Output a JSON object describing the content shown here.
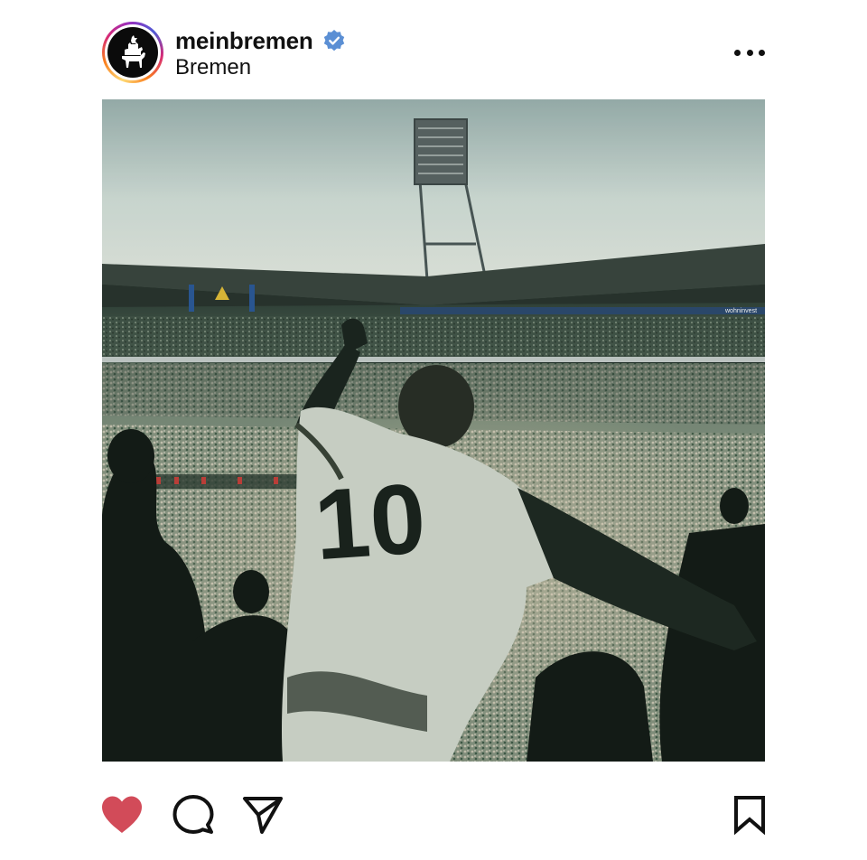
{
  "post": {
    "username": "meinbremen",
    "verified": true,
    "location": "Bremen",
    "liked": true
  },
  "icons": {
    "avatar": "bremen-town-musicians-logo-icon",
    "verified": "verified-badge-icon",
    "more": "more-options-icon",
    "like": "heart-icon",
    "comment": "comment-icon",
    "share": "paper-plane-icon",
    "save": "bookmark-icon"
  },
  "colors": {
    "like": "#d24b59",
    "verified": "#5b8fd4",
    "text": "#111111"
  },
  "photo": {
    "shirt_number": "10",
    "banner_text": "wohninvest"
  }
}
